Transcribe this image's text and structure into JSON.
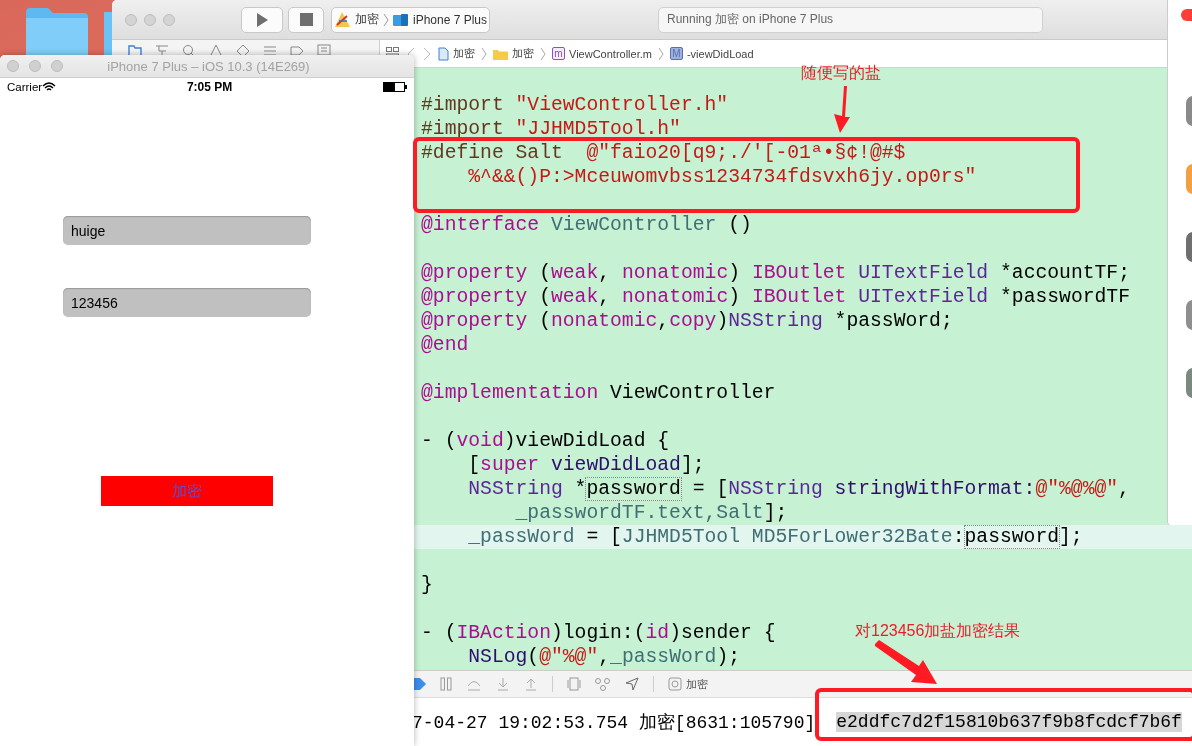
{
  "xcode": {
    "toolbar": {
      "scheme": {
        "target": "加密",
        "device": "iPhone 7 Plus"
      },
      "activity": "Running 加密 on iPhone 7 Plus"
    },
    "jump_bar": [
      {
        "kind": "project",
        "label": "加密"
      },
      {
        "kind": "folder",
        "label": "加密"
      },
      {
        "kind": "source",
        "badge": "m",
        "label": "ViewController.m"
      },
      {
        "kind": "method",
        "badge": "M",
        "label": "-viewDidLoad"
      }
    ],
    "code_lines": [
      {
        "current": false,
        "tokens": [
          {
            "kind": "pre",
            "text": "#import "
          },
          {
            "kind": "str",
            "text": "\"ViewController.h\""
          }
        ]
      },
      {
        "current": false,
        "tokens": [
          {
            "kind": "pre",
            "text": "#import "
          },
          {
            "kind": "str",
            "text": "\"JJHMD5Tool.h\""
          }
        ]
      },
      {
        "current": false,
        "tokens": [
          {
            "kind": "pre",
            "text": "#define Salt  "
          },
          {
            "kind": "str",
            "text": "@\"faio20[q9;./'[-01ª•§¢!@#$"
          }
        ]
      },
      {
        "current": false,
        "tokens": [
          {
            "kind": "str",
            "text": "    %^&&()P:>Mceuwomvbss1234734fdsvxh6jy.op0rs\""
          }
        ]
      },
      {
        "current": false
      },
      {
        "current": false,
        "tokens": [
          {
            "kind": "kw",
            "text": "@interface "
          },
          {
            "kind": "proj",
            "text": "ViewController"
          },
          {
            "kind": "plain",
            "text": " ()"
          }
        ]
      },
      {
        "current": false
      },
      {
        "current": false,
        "tokens": [
          {
            "kind": "kw",
            "text": "@property"
          },
          {
            "kind": "plain",
            "text": " ("
          },
          {
            "kind": "kw",
            "text": "weak"
          },
          {
            "kind": "plain",
            "text": ", "
          },
          {
            "kind": "kw",
            "text": "nonatomic"
          },
          {
            "kind": "plain",
            "text": ") "
          },
          {
            "kind": "kw",
            "text": "IBOutlet "
          },
          {
            "kind": "type",
            "text": "UITextField"
          },
          {
            "kind": "plain",
            "text": " *accountTF;"
          }
        ]
      },
      {
        "current": false,
        "tokens": [
          {
            "kind": "kw",
            "text": "@property"
          },
          {
            "kind": "plain",
            "text": " ("
          },
          {
            "kind": "kw",
            "text": "weak"
          },
          {
            "kind": "plain",
            "text": ", "
          },
          {
            "kind": "kw",
            "text": "nonatomic"
          },
          {
            "kind": "plain",
            "text": ") "
          },
          {
            "kind": "kw",
            "text": "IBOutlet "
          },
          {
            "kind": "type",
            "text": "UITextField"
          },
          {
            "kind": "plain",
            "text": " *passwordTF"
          }
        ]
      },
      {
        "current": false,
        "tokens": [
          {
            "kind": "kw",
            "text": "@property"
          },
          {
            "kind": "plain",
            "text": " ("
          },
          {
            "kind": "kw",
            "text": "nonatomic"
          },
          {
            "kind": "plain",
            "text": ","
          },
          {
            "kind": "kw",
            "text": "copy"
          },
          {
            "kind": "plain",
            "text": ")"
          },
          {
            "kind": "type",
            "text": "NSString"
          },
          {
            "kind": "plain",
            "text": " *passWord;"
          }
        ]
      },
      {
        "current": false,
        "tokens": [
          {
            "kind": "kw",
            "text": "@end"
          }
        ]
      },
      {
        "current": false
      },
      {
        "current": false,
        "tokens": [
          {
            "kind": "kw",
            "text": "@implementation"
          },
          {
            "kind": "plain",
            "text": " ViewController"
          }
        ]
      },
      {
        "current": false
      },
      {
        "current": false,
        "tokens": [
          {
            "kind": "plain",
            "text": "- ("
          },
          {
            "kind": "kw",
            "text": "void"
          },
          {
            "kind": "plain",
            "text": ")viewDidLoad {"
          }
        ]
      },
      {
        "current": false,
        "tokens": [
          {
            "kind": "plain",
            "text": "    ["
          },
          {
            "kind": "kw",
            "text": "super"
          },
          {
            "kind": "method",
            "text": " viewDidLoad"
          },
          {
            "kind": "plain",
            "text": "];"
          }
        ]
      },
      {
        "current": false,
        "tokens": [
          {
            "kind": "type",
            "text": "    NSString"
          },
          {
            "kind": "plain",
            "text": " *"
          },
          {
            "kind": "var",
            "text": "password"
          },
          {
            "kind": "plain",
            "text": " = ["
          },
          {
            "kind": "type",
            "text": "NSString"
          },
          {
            "kind": "method",
            "text": " stringWithFormat:"
          },
          {
            "kind": "str",
            "text": "@\"%@%@\""
          },
          {
            "kind": "plain",
            "text": ","
          }
        ]
      },
      {
        "current": false,
        "tokens": [
          {
            "kind": "proj",
            "text": "        _passwordTF.text,Salt"
          },
          {
            "kind": "plain",
            "text": "];"
          }
        ]
      },
      {
        "current": true,
        "tokens": [
          {
            "kind": "proj",
            "text": "    _passWord"
          },
          {
            "kind": "plain",
            "text": " = ["
          },
          {
            "kind": "proj",
            "text": "JJHMD5Tool MD5ForLower32Bate"
          },
          {
            "kind": "plain",
            "text": ":"
          },
          {
            "kind": "var",
            "text": "password"
          },
          {
            "kind": "plain",
            "text": "];"
          }
        ]
      },
      {
        "current": false
      },
      {
        "current": false,
        "tokens": [
          {
            "kind": "plain",
            "text": "}"
          }
        ]
      },
      {
        "current": false
      },
      {
        "current": false,
        "tokens": [
          {
            "kind": "plain",
            "text": "- ("
          },
          {
            "kind": "kw",
            "text": "IBAction"
          },
          {
            "kind": "plain",
            "text": ")login:("
          },
          {
            "kind": "kw",
            "text": "id"
          },
          {
            "kind": "plain",
            "text": ")sender {"
          }
        ]
      },
      {
        "current": false,
        "tokens": [
          {
            "kind": "method",
            "text": "    NSLog"
          },
          {
            "kind": "plain",
            "text": "("
          },
          {
            "kind": "str",
            "text": "@\"%@\""
          },
          {
            "kind": "plain",
            "text": ","
          },
          {
            "kind": "proj",
            "text": "_passWord"
          },
          {
            "kind": "plain",
            "text": ");"
          }
        ]
      }
    ],
    "debug_bar": {
      "target": "加密"
    },
    "console": {
      "text": "7-04-27 19:02:53.754 加密[8631:105790]",
      "selection": "e2ddfc7d2f15810b637f9b8fcdcf7b6f"
    }
  },
  "simulator": {
    "title": "iPhone 7 Plus – iOS 10.3 (14E269)",
    "status_bar": {
      "carrier": "Carrier",
      "time": "7:05 PM"
    },
    "fields": [
      {
        "value": "huige"
      },
      {
        "value": "123456"
      }
    ],
    "button": "加密"
  },
  "annotations": [
    {
      "kind": "salt",
      "text": "随便写的盐"
    },
    {
      "kind": "result",
      "text": "对123456加盐加密结果"
    }
  ]
}
